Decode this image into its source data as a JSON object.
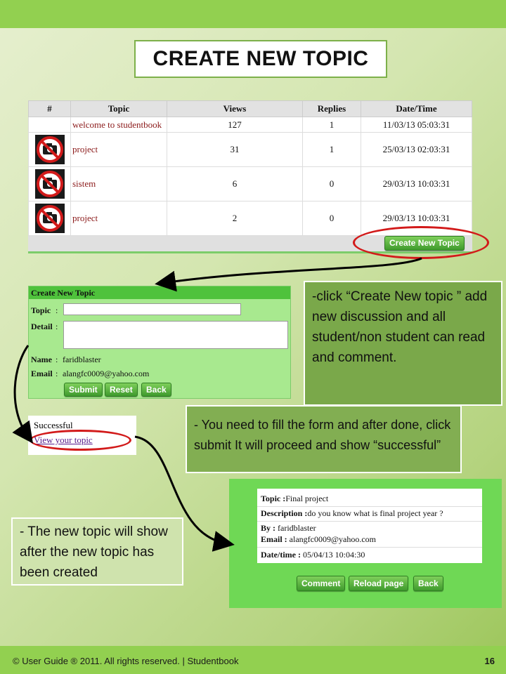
{
  "title": "CREATE NEW TOPIC",
  "topics_table": {
    "headers": [
      "#",
      "Topic",
      "Views",
      "Replies",
      "Date/Time"
    ],
    "rows": [
      {
        "icon": "",
        "topic": "welcome to studentbook",
        "views": "127",
        "replies": "1",
        "datetime": "11/03/13 05:03:31"
      },
      {
        "icon": "no-camera-icon",
        "topic": "project",
        "views": "31",
        "replies": "1",
        "datetime": "25/03/13 02:03:31"
      },
      {
        "icon": "no-camera-icon",
        "topic": "sistem",
        "views": "6",
        "replies": "0",
        "datetime": "29/03/13 10:03:31"
      },
      {
        "icon": "no-camera-icon",
        "topic": "project",
        "views": "2",
        "replies": "0",
        "datetime": "29/03/13 10:03:31"
      }
    ],
    "create_button": "Create New Topic"
  },
  "form": {
    "header": "Create New Topic",
    "topic_label": "Topic",
    "detail_label": "Detail",
    "name_label": "Name",
    "name_value": "faridblaster",
    "email_label": "Email",
    "email_value": "alangfc0009@yahoo.com",
    "submit": "Submit",
    "reset": "Reset",
    "back": "Back",
    "colon": ":"
  },
  "success": {
    "text": "Successful",
    "link": "View your topic"
  },
  "notes": {
    "note1": "-click “Create New topic ” add new discussion and all student/non student can read and comment.",
    "note2": "- You need to fill the form and after done, click submit It will proceed and show “successful”",
    "note3": "- The new topic will show after the new topic has been created"
  },
  "result": {
    "topic_label": "Topic :",
    "topic_value": "Final project",
    "desc_label": "Description :",
    "desc_value": "do you know what is final project year ?",
    "by_label": "By :",
    "by_value": " faridblaster",
    "email_label": "Email :",
    "email_value": " alangfc0009@yahoo.com",
    "datetime_label": "Date/time :",
    "datetime_value": " 05/04/13 10:04:30",
    "comment": "Comment",
    "reload": "Reload page",
    "back": "Back"
  },
  "footer": {
    "text": "© User Guide ® 2011. All rights reserved. | Studentbook",
    "page": "16"
  },
  "colors": {
    "accent": "#92d050",
    "highlight": "#d21a1a"
  }
}
